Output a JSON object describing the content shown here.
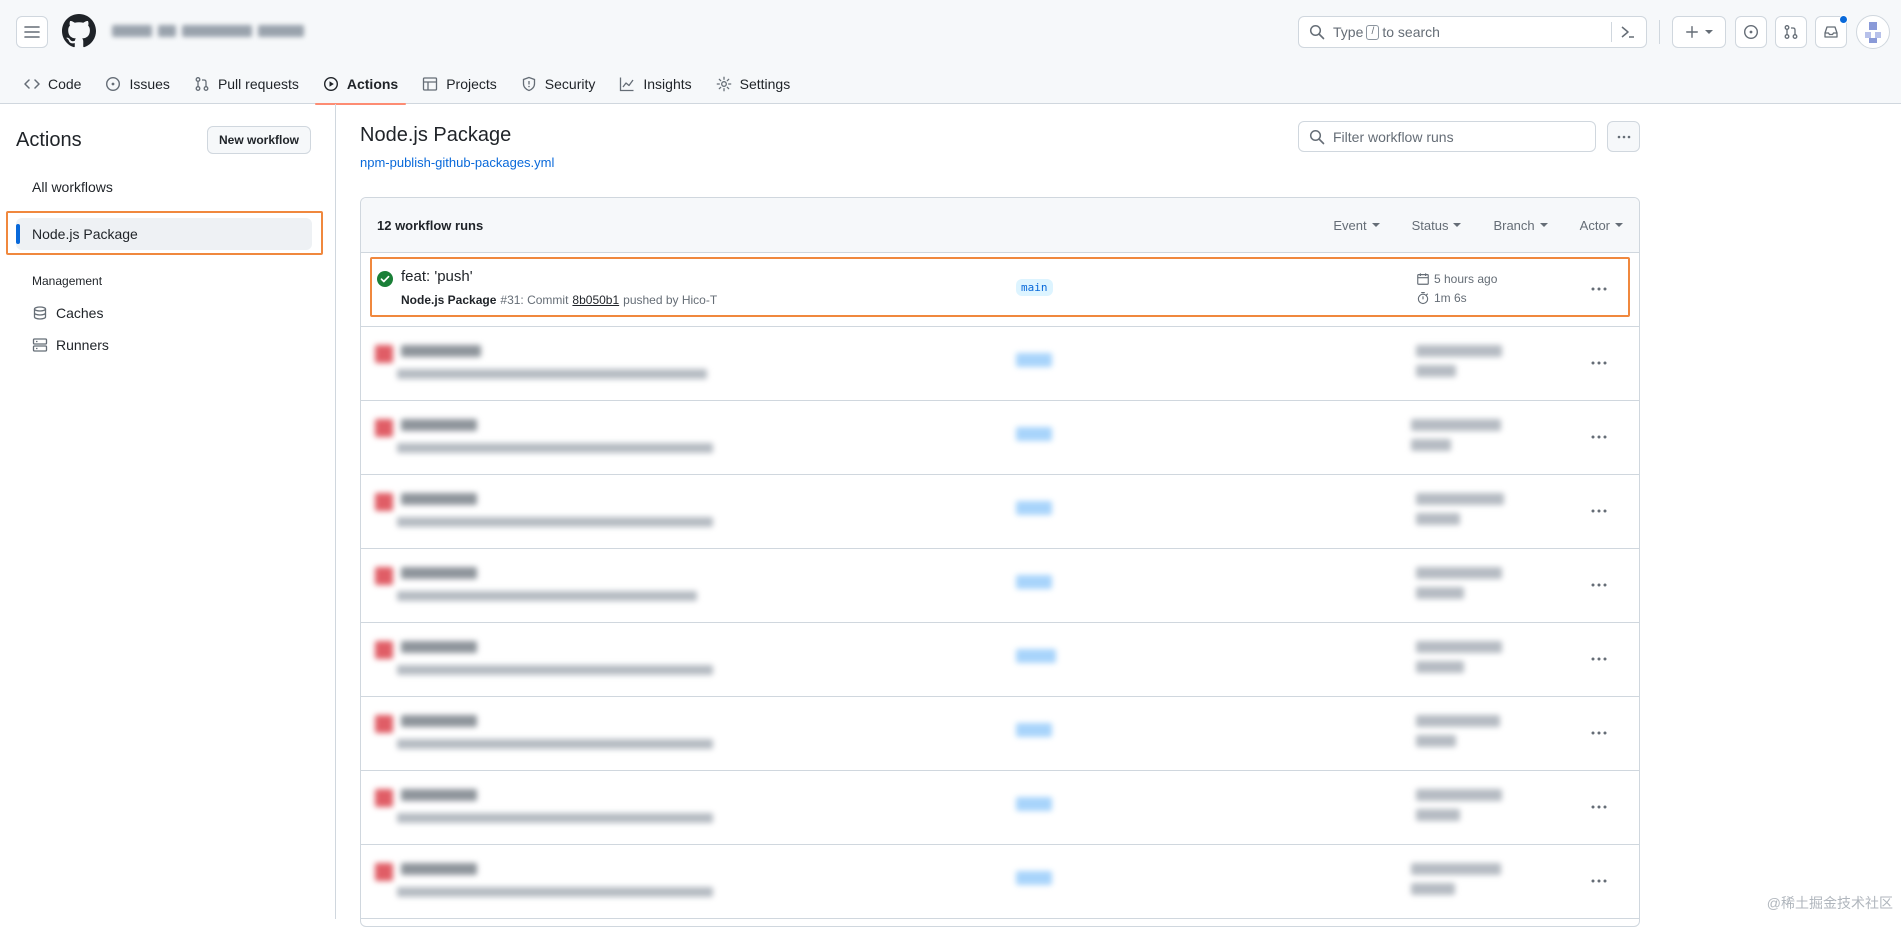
{
  "header": {
    "search_placeholder": "Type",
    "search_key": "/",
    "search_suffix": "to search"
  },
  "tabs": [
    {
      "label": "Code"
    },
    {
      "label": "Issues"
    },
    {
      "label": "Pull requests"
    },
    {
      "label": "Actions"
    },
    {
      "label": "Projects"
    },
    {
      "label": "Security"
    },
    {
      "label": "Insights"
    },
    {
      "label": "Settings"
    }
  ],
  "sidebar": {
    "title": "Actions",
    "new_workflow": "New workflow",
    "all_workflows": "All workflows",
    "selected_workflow": "Node.js Package",
    "section": "Management",
    "caches": "Caches",
    "runners": "Runners"
  },
  "main": {
    "title": "Node.js Package",
    "file": "npm-publish-github-packages.yml",
    "filter_placeholder": "Filter workflow runs",
    "runs_count": "12 workflow runs",
    "filters": [
      "Event",
      "Status",
      "Branch",
      "Actor"
    ]
  },
  "runs": {
    "first": {
      "title": "feat: 'push'",
      "workflow": "Node.js Package",
      "run_number": "#31: Commit",
      "sha": "8b050b1",
      "pushed_by": "pushed by Hico-T",
      "branch": "main",
      "time_ago": "5 hours ago",
      "duration": "1m 6s"
    }
  },
  "watermark": "@稀土掘金技术社区",
  "colors": {
    "accent": "#0969da",
    "success": "#1a7f37",
    "failure": "#cf222e",
    "highlight": "#f0883e",
    "tab_underline": "#fd8c73"
  }
}
